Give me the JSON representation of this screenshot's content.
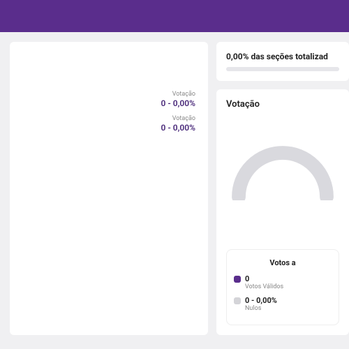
{
  "colors": {
    "primary": "#5a2d8c",
    "muted": "#d4d4d8"
  },
  "left": {
    "rows": [
      {
        "label": "Votação",
        "value": "0 - 0,00%"
      },
      {
        "label": "Votação",
        "value": "0 - 0,00%"
      }
    ]
  },
  "sections": {
    "title": "0,00% das seções totalizad",
    "progress_pct": 0
  },
  "votacao": {
    "title": "Votação"
  },
  "legend": {
    "title": "Votos a",
    "items": [
      {
        "swatch": "purple",
        "value": "0",
        "sub": "Votos Válidos"
      },
      {
        "swatch": "grey",
        "value": "0 - 0,00%",
        "sub": "Nulos"
      }
    ]
  }
}
